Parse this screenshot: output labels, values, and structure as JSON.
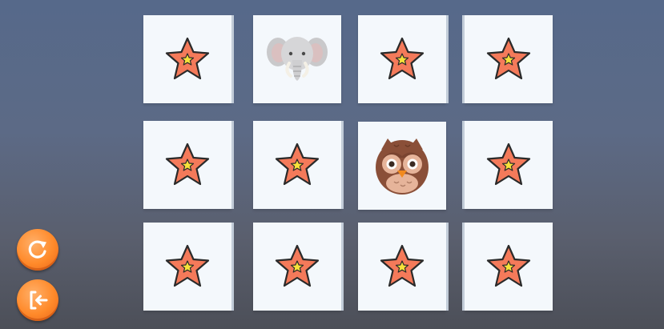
{
  "game": {
    "card_back_icon": "star-icon",
    "colors": {
      "star_fill": "#f47a5a",
      "star_center": "#f7e23a",
      "card_face": "#f4f8fc",
      "button_orange": "#ff8a2a"
    }
  },
  "board": {
    "cards": [
      {
        "state": "hidden",
        "face": "star-icon"
      },
      {
        "state": "revealed",
        "face": "elephant-icon"
      },
      {
        "state": "hidden",
        "face": "star-icon"
      },
      {
        "state": "hidden",
        "face": "star-icon"
      },
      {
        "state": "hidden",
        "face": "star-icon"
      },
      {
        "state": "hidden",
        "face": "star-icon"
      },
      {
        "state": "revealed",
        "face": "owl-icon"
      },
      {
        "state": "hidden",
        "face": "star-icon"
      },
      {
        "state": "hidden",
        "face": "star-icon"
      },
      {
        "state": "hidden",
        "face": "star-icon"
      },
      {
        "state": "hidden",
        "face": "star-icon"
      },
      {
        "state": "hidden",
        "face": "star-icon"
      }
    ]
  },
  "controls": {
    "restart_icon": "restart-icon",
    "exit_icon": "exit-icon"
  }
}
